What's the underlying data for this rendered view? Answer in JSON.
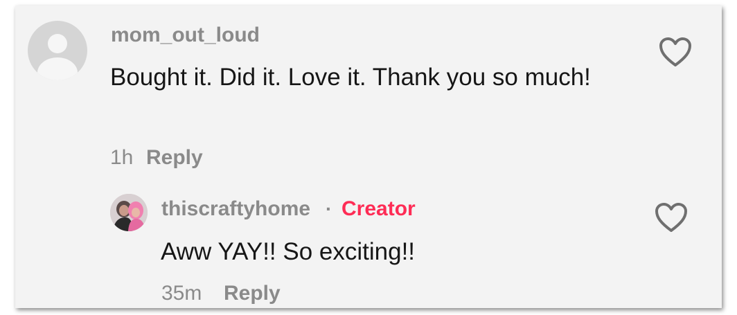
{
  "comments": [
    {
      "username": "mom_out_loud",
      "text": "Bought it. Did it. Love it. Thank you so much!",
      "time": "1h",
      "reply_label": "Reply",
      "avatar": "default-avatar-icon",
      "like_icon": "heart-outline-icon"
    }
  ],
  "replies": [
    {
      "username": "thiscraftyhome",
      "separator": "·",
      "badge": "Creator",
      "badge_color": "#fe2c55",
      "text": "Aww YAY!! So exciting!!",
      "time": "35m",
      "reply_label": "Reply",
      "avatar": "profile-photo",
      "like_icon": "heart-outline-icon"
    }
  ]
}
